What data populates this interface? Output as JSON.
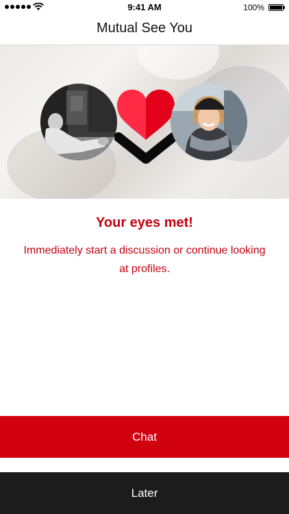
{
  "status_bar": {
    "time": "9:41 AM",
    "battery": "100%"
  },
  "nav": {
    "title": "Mutual See You"
  },
  "match": {
    "title": "Your eyes met!",
    "message": "Immediately start a discussion or continue looking at profiles."
  },
  "actions": {
    "chat_label": "Chat",
    "later_label": "Later"
  },
  "colors": {
    "accent": "#d0000f",
    "heart_light": "#ff2b45",
    "heart_dark": "#e2001a",
    "later_bg": "#1c1c1c"
  }
}
